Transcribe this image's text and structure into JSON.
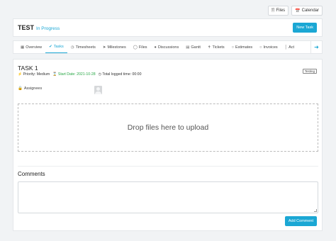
{
  "topbar": {
    "files_label": "Files",
    "files_icon": "file-icon",
    "calendar_label": "Calendar",
    "calendar_icon": "calendar-icon"
  },
  "project": {
    "title": "TEST",
    "status": "In Progress",
    "new_task_label": "New Task"
  },
  "tabs": [
    {
      "label": "Overview",
      "icon": "overview-icon"
    },
    {
      "label": "Tasks",
      "icon": "check-circle-icon",
      "active": true
    },
    {
      "label": "Timesheets",
      "icon": "clock-icon"
    },
    {
      "label": "Milestones",
      "icon": "rocket-icon"
    },
    {
      "label": "Files",
      "icon": "files-icon"
    },
    {
      "label": "Discussions",
      "icon": "chat-icon"
    },
    {
      "label": "Gantt",
      "icon": "gantt-icon"
    },
    {
      "label": "Tickets",
      "icon": "ticket-icon"
    },
    {
      "label": "Estimates",
      "icon": "estimate-icon"
    },
    {
      "label": "Invoices",
      "icon": "invoice-icon"
    },
    {
      "label": "Act",
      "icon": "activity-icon"
    }
  ],
  "task": {
    "title": "TASK 1",
    "label": "Testing",
    "priority": "Priority: Medium",
    "start_date": "Start Date: 2021-10-28",
    "logged_time": "Total logged time: 00:00",
    "assignees_label": "Assignees",
    "dropzone_text": "Drop files here to upload",
    "comments_title": "Comments",
    "add_comment_label": "Add Comment"
  },
  "colors": {
    "accent": "#1ba7d4",
    "success": "#28a745"
  }
}
